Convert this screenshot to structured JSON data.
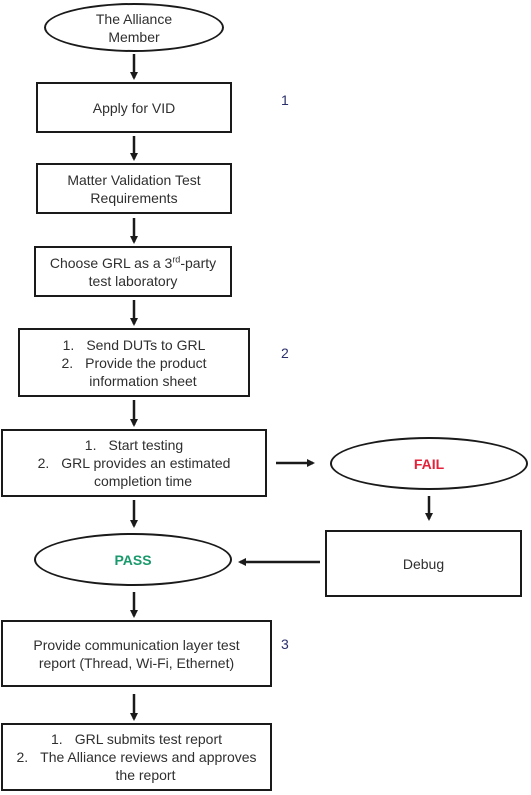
{
  "diagram": {
    "nodes": {
      "start": {
        "label_line1": "The Alliance",
        "label_line2": "Member"
      },
      "apply_vid": {
        "label": "Apply for VID"
      },
      "matter_requirements": {
        "label_line1": "Matter Validation Test",
        "label_line2": "Requirements"
      },
      "choose_grl": {
        "label_pre": "Choose GRL as a 3",
        "label_sup": "rd",
        "label_post": "-party",
        "label_line2": "test laboratory"
      },
      "send_duts": {
        "items": [
          {
            "num": "1.",
            "text": "Send DUTs to GRL"
          },
          {
            "num": "2.",
            "text": "Provide the product",
            "text_cont": "information sheet"
          }
        ]
      },
      "start_testing": {
        "items": [
          {
            "num": "1.",
            "text": "Start testing"
          },
          {
            "num": "2.",
            "text": "GRL provides an estimated",
            "text_cont": "completion time"
          }
        ]
      },
      "fail": {
        "label": "FAIL",
        "color": "#e5213a"
      },
      "debug": {
        "label": "Debug"
      },
      "pass": {
        "label": "PASS",
        "color": "#1a9a6c"
      },
      "comm_report": {
        "label_line1": "Provide communication layer test",
        "label_line2": "report (Thread, Wi-Fi, Ethernet)"
      },
      "submit_report": {
        "items": [
          {
            "num": "1.",
            "text": "GRL submits test report"
          },
          {
            "num": "2.",
            "text": "The Alliance reviews and approves",
            "text_cont": "the report"
          }
        ]
      }
    },
    "step_numbers": [
      "1",
      "2",
      "3"
    ],
    "edges": [
      {
        "from": "start",
        "to": "apply_vid"
      },
      {
        "from": "apply_vid",
        "to": "matter_requirements"
      },
      {
        "from": "matter_requirements",
        "to": "choose_grl"
      },
      {
        "from": "choose_grl",
        "to": "send_duts"
      },
      {
        "from": "send_duts",
        "to": "start_testing"
      },
      {
        "from": "start_testing",
        "to": "fail"
      },
      {
        "from": "start_testing",
        "to": "pass"
      },
      {
        "from": "fail",
        "to": "debug"
      },
      {
        "from": "debug",
        "to": "pass"
      },
      {
        "from": "pass",
        "to": "comm_report"
      },
      {
        "from": "comm_report",
        "to": "submit_report"
      }
    ],
    "colors": {
      "stroke": "#1a1a1a",
      "step_number": "#2a2f6b"
    }
  }
}
